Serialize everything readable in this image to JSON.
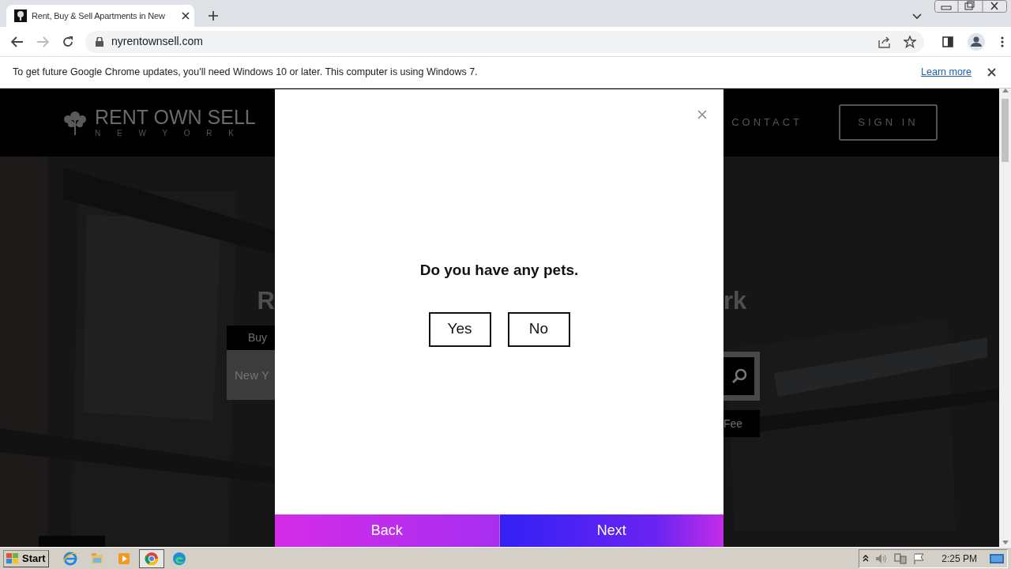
{
  "browser": {
    "tabs": [
      {
        "title": "Rent, Buy & Sell Apartments in New",
        "selected": true
      }
    ],
    "address": "nyrentownsell.com",
    "infobar": {
      "message": "To get future Google Chrome updates, you'll need Windows 10 or later. This computer is using Windows 7.",
      "link": "Learn more"
    }
  },
  "site": {
    "logo": {
      "name": "RENT OWN SELL",
      "sub": "N E W Y O R K"
    },
    "nav": [
      {
        "label": "CONTACT",
        "kind": "link"
      },
      {
        "label": "SIGN IN",
        "kind": "button"
      }
    ]
  },
  "hero": {
    "heading_left": "R",
    "heading_right": "rk",
    "tab": "Buy",
    "search_placeholder": "New Y",
    "filter": "Fee"
  },
  "modal": {
    "question": "Do you have any pets.",
    "options": [
      {
        "label": "Yes",
        "selected": false
      },
      {
        "label": "No",
        "selected": false
      }
    ],
    "footer": [
      {
        "label": "Back",
        "kind": "back"
      },
      {
        "label": "Next",
        "kind": "next"
      }
    ]
  },
  "taskbar": {
    "start": "Start",
    "apps": [
      {
        "kind": "ie",
        "active": false
      },
      {
        "kind": "folder",
        "active": false
      },
      {
        "kind": "media",
        "active": false
      },
      {
        "kind": "chrome",
        "active": true
      },
      {
        "kind": "edge",
        "active": false
      }
    ],
    "clock": "2:25 PM"
  }
}
